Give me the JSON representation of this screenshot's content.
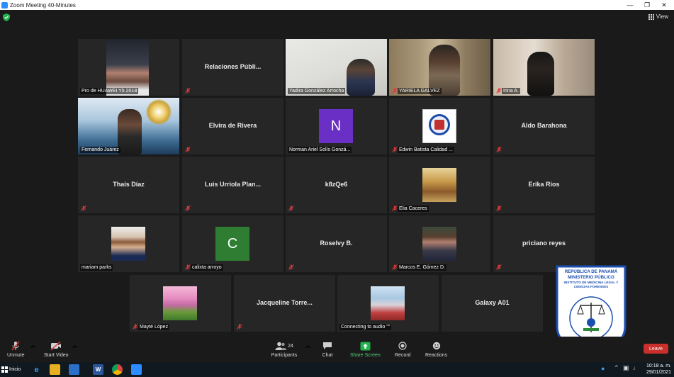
{
  "window": {
    "title": "Zoom Meeting 40-Minutes"
  },
  "topbar": {
    "view_label": "View"
  },
  "tiles": [
    {
      "label": "Pro de HUAWEI Y5 2018"
    },
    {
      "name": "Relaciones  Públi..."
    },
    {
      "label": "Yadira González Arrocha"
    },
    {
      "label": "YARIELA GALVEZ"
    },
    {
      "label": "Irina A."
    },
    {
      "label": "Fernando Juárez"
    },
    {
      "name": "Elvira de Rivera"
    },
    {
      "label": "Norman Ariel Solís Gonzá...",
      "avatar_letter": "N"
    },
    {
      "label": "Edwin Batista Calidad ..."
    },
    {
      "name": "Aldo Barahona"
    },
    {
      "name": "Thais Díaz"
    },
    {
      "name": "Luis  Urriola  Plan..."
    },
    {
      "name": "k8zQe6"
    },
    {
      "label": "Elia Caceres"
    },
    {
      "name": "Erika Rios"
    },
    {
      "label": "mariam parks"
    },
    {
      "label": "calixta arroyo",
      "avatar_letter": "C"
    },
    {
      "name": "Roselvy B."
    },
    {
      "label": "Marcos E. Gómez D."
    },
    {
      "name": "priciano reyes"
    },
    {
      "label": "Mayté López"
    },
    {
      "name": "Jacqueline  Torre..."
    },
    {
      "label": "Connecting to audio \"\""
    },
    {
      "name": "Galaxy A01"
    }
  ],
  "toolbar": {
    "unmute": "Unmute",
    "start_video": "Start Video",
    "participants": "Participants",
    "participants_count": "24",
    "chat": "Chat",
    "share_screen": "Share Screen",
    "record": "Record",
    "reactions": "Reactions",
    "leave": "Leave"
  },
  "taskbar": {
    "start": "Inicio",
    "time": "10:18 a. m.",
    "date": "29/01/2021"
  },
  "logo": {
    "line1": "REPÚBLICA DE PANAMÁ",
    "line2": "MINISTERIO PÚBLICO",
    "arc": "INSTITUTO DE MEDICINA LEGAL Y CIENCIAS FORENSES"
  },
  "colors": {
    "active_speaker": "#b9e76a",
    "avatar_n": "#6a2fc4",
    "avatar_c": "#2e7d32",
    "leave": "#c9302c",
    "share": "#22b14c"
  }
}
